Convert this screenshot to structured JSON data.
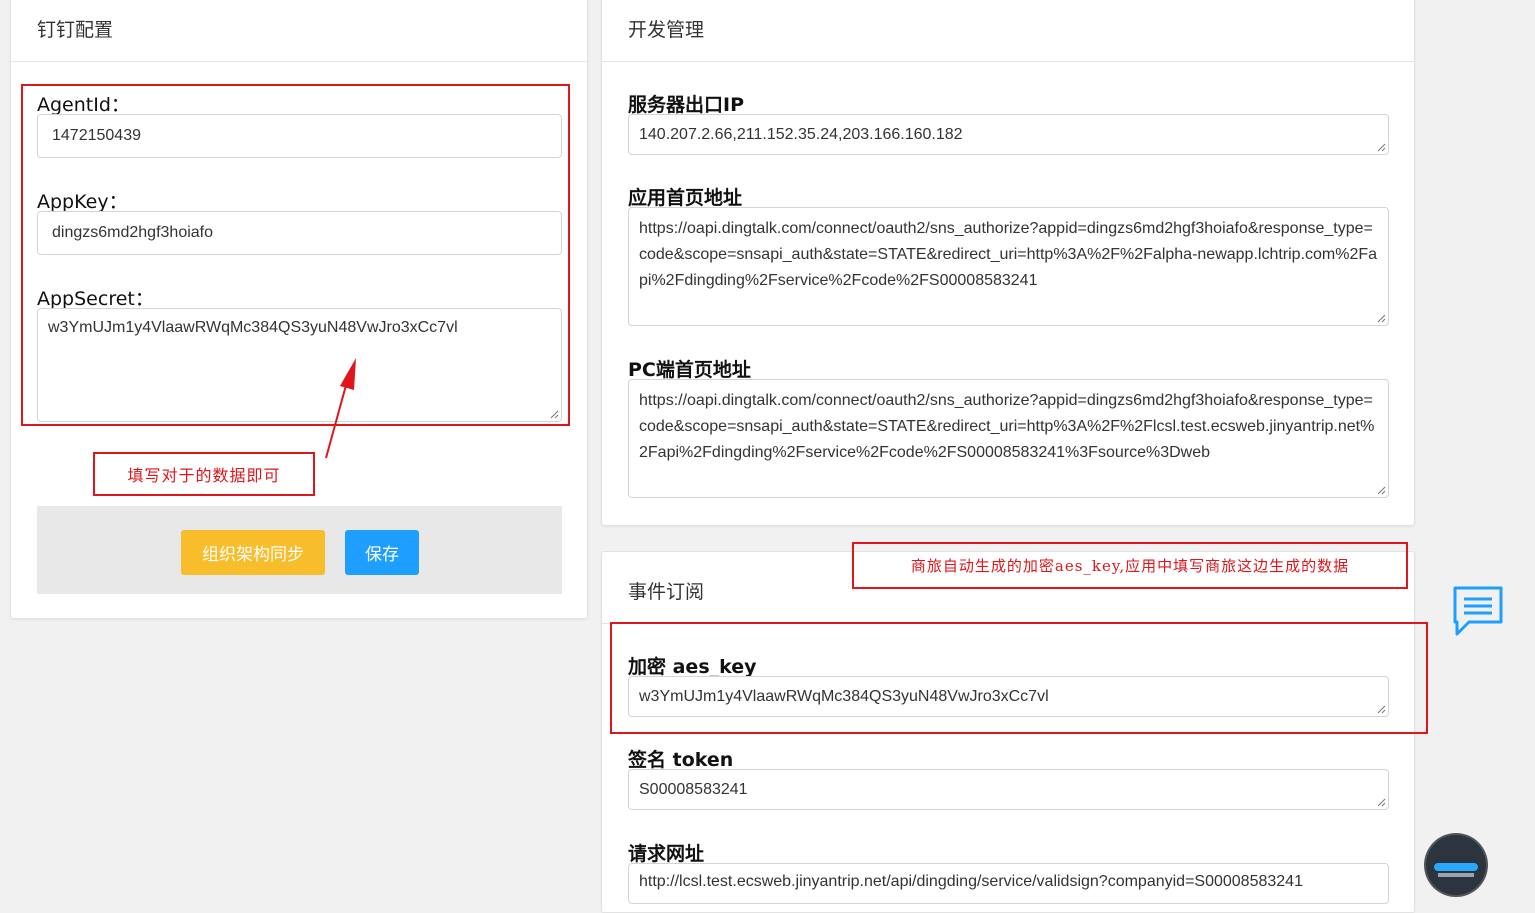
{
  "dingtalk": {
    "title": "钉钉配置",
    "agent_id": {
      "label": "AgentId：",
      "value": "1472150439"
    },
    "app_key": {
      "label": "AppKey：",
      "value": "dingzs6md2hgf3hoiafo"
    },
    "app_secret": {
      "label": "AppSecret：",
      "value": "w3YmUJm1y4VlaawRWqMc384QS3yuN48VwJro3xCc7vl"
    },
    "sync_button": "组织架构同步",
    "save_button": "保存"
  },
  "dev": {
    "title": "开发管理",
    "server_ip": {
      "label": "服务器出口IP",
      "value": "140.207.2.66,211.152.35.24,203.166.160.182"
    },
    "home_url": {
      "label": "应用首页地址",
      "value": "https://oapi.dingtalk.com/connect/oauth2/sns_authorize?appid=dingzs6md2hgf3hoiafo&response_type=code&scope=snsapi_auth&state=STATE&redirect_uri=http%3A%2F%2Falpha-newapp.lchtrip.com%2Fapi%2Fdingding%2Fservice%2Fcode%2FS00008583241"
    },
    "pc_url": {
      "label": "PC端首页地址",
      "value": "https://oapi.dingtalk.com/connect/oauth2/sns_authorize?appid=dingzs6md2hgf3hoiafo&response_type=code&scope=snsapi_auth&state=STATE&redirect_uri=http%3A%2F%2Flcsl.test.ecsweb.jinyantrip.net%2Fapi%2Fdingding%2Fservice%2Fcode%2FS00008583241%3Fsource%3Dweb"
    }
  },
  "event": {
    "title": "事件订阅",
    "aes_key": {
      "label": "加密 aes_key",
      "value": "w3YmUJm1y4VlaawRWqMc384QS3yuN48VwJro3xCc7vl"
    },
    "token": {
      "label": "签名 token",
      "value": "S00008583241"
    },
    "request_url": {
      "label": "请求网址",
      "value": "http://lcsl.test.ecsweb.jinyantrip.net/api/dingding/service/validsign?companyid=S00008583241"
    }
  },
  "annotations": {
    "fill_note": "填写对于的数据即可",
    "aes_note": "商旅自动生成的加密aes_key,应用中填写商旅这边生成的数据"
  },
  "colors": {
    "annotation_red": "#e0161b",
    "sync_button_bg": "#f8bd2b",
    "save_button_bg": "#1e9fff",
    "chat_icon": "#1e9fff"
  },
  "icons": {
    "chat": "chat-bubble-icon",
    "assistant": "assistant-avatar-icon"
  }
}
